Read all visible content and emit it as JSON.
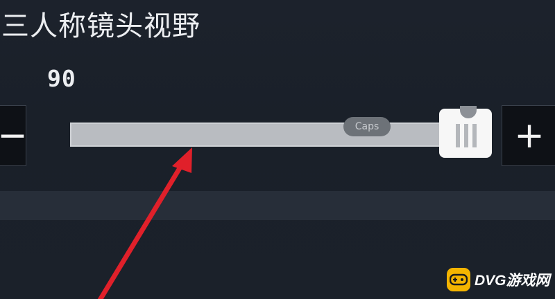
{
  "setting": {
    "title": "三人称镜头视野",
    "value": "90",
    "slider_level_percent": 100
  },
  "controls": {
    "decrease_label": "−",
    "increase_label": "+"
  },
  "overlay": {
    "caps_badge": "Caps"
  },
  "watermark": {
    "text": "DVG游戏网"
  },
  "colors": {
    "arrow": "#e0202a",
    "watermark_icon": "#f4b400"
  }
}
